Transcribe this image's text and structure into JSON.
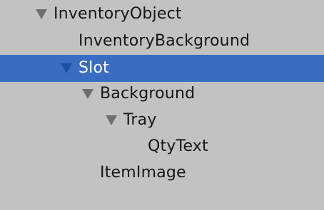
{
  "hierarchy": {
    "items": [
      {
        "label": "InventoryObject",
        "expanded": true,
        "selected": false,
        "depth": 0,
        "icon": "triangle-down-icon"
      },
      {
        "label": "InventoryBackground",
        "expanded": false,
        "selected": false,
        "depth": 1,
        "icon": ""
      },
      {
        "label": "Slot",
        "expanded": true,
        "selected": true,
        "depth": 1,
        "icon": "triangle-down-icon"
      },
      {
        "label": "Background",
        "expanded": true,
        "selected": false,
        "depth": 2,
        "icon": "triangle-down-icon"
      },
      {
        "label": "Tray",
        "expanded": true,
        "selected": false,
        "depth": 3,
        "icon": "triangle-down-icon"
      },
      {
        "label": "QtyText",
        "expanded": false,
        "selected": false,
        "depth": 4,
        "icon": ""
      },
      {
        "label": "ItemImage",
        "expanded": false,
        "selected": false,
        "depth": 2,
        "icon": ""
      }
    ]
  },
  "colors": {
    "background": "#c2c2c2",
    "selection": "#3b6cc3",
    "text": "#161616",
    "selected_text": "#ffffff",
    "caret": "#6e6e6e",
    "caret_selected": "#1e4fa8"
  }
}
